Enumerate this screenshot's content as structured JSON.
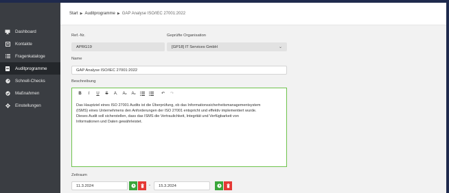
{
  "colors": {
    "sidebar_bg": "#3a3d42",
    "sidebar_active_bg": "#24272b",
    "content_bg": "#f2f2f2",
    "frame": "#1f2a4d",
    "green": "#3aa63a",
    "red": "#e53935",
    "editor_border": "#6cc24a"
  },
  "sidebar": {
    "items": [
      {
        "label": "Dashboard",
        "icon": "monitor-icon"
      },
      {
        "label": "Kontakte",
        "icon": "contact-card-icon"
      },
      {
        "label": "Fragenkataloge",
        "icon": "list-icon"
      },
      {
        "label": "Auditprogramme",
        "icon": "document-icon",
        "active": true
      },
      {
        "label": "Schnell-Checks",
        "icon": "gauge-icon"
      },
      {
        "label": "Maßnahmen",
        "icon": "check-circle-icon"
      },
      {
        "label": "Einstellungen",
        "icon": "gear-icon"
      }
    ]
  },
  "breadcrumb": [
    "Start",
    "Auditprogramme",
    "GAP Analyse ISO/IEC 27001:2022"
  ],
  "form": {
    "ref_label": "Ref.-Nr.",
    "ref_value": "APRG19",
    "org_label": "Geprüfte Organisation",
    "org_value": "[GP18] IT Services GmbH",
    "name_label": "Name",
    "name_value": "GAP Analyse ISO/IEC 27001:2022",
    "desc_label": "Beschreibung",
    "desc_lines": [
      "Das Hauptziel eines ISO 27001 Audits ist die Überprüfung, ob das Informationssicherheitsmanagementsystem",
      "(ISMS) eines Unternehmens den Anforderungen der ISO 27001 entspricht und effektiv implementiert wurde.",
      "Dieses Audit soll sicherstellen, dass das ISMS die Vertraulichkeit, Integrität und Verfügbarkeit von",
      "Informationen und Daten gewährleistet."
    ],
    "period_label": "Zeitraum",
    "start_date": "11.3.2024",
    "end_date": "15.3.2024",
    "separator": "-"
  },
  "toolbar": {
    "bold": "B",
    "italic": "I",
    "underline": "U",
    "strike": "S",
    "font_size": "A",
    "superscript": "A",
    "subscript": "A",
    "undo": "↶",
    "redo": "↷"
  }
}
